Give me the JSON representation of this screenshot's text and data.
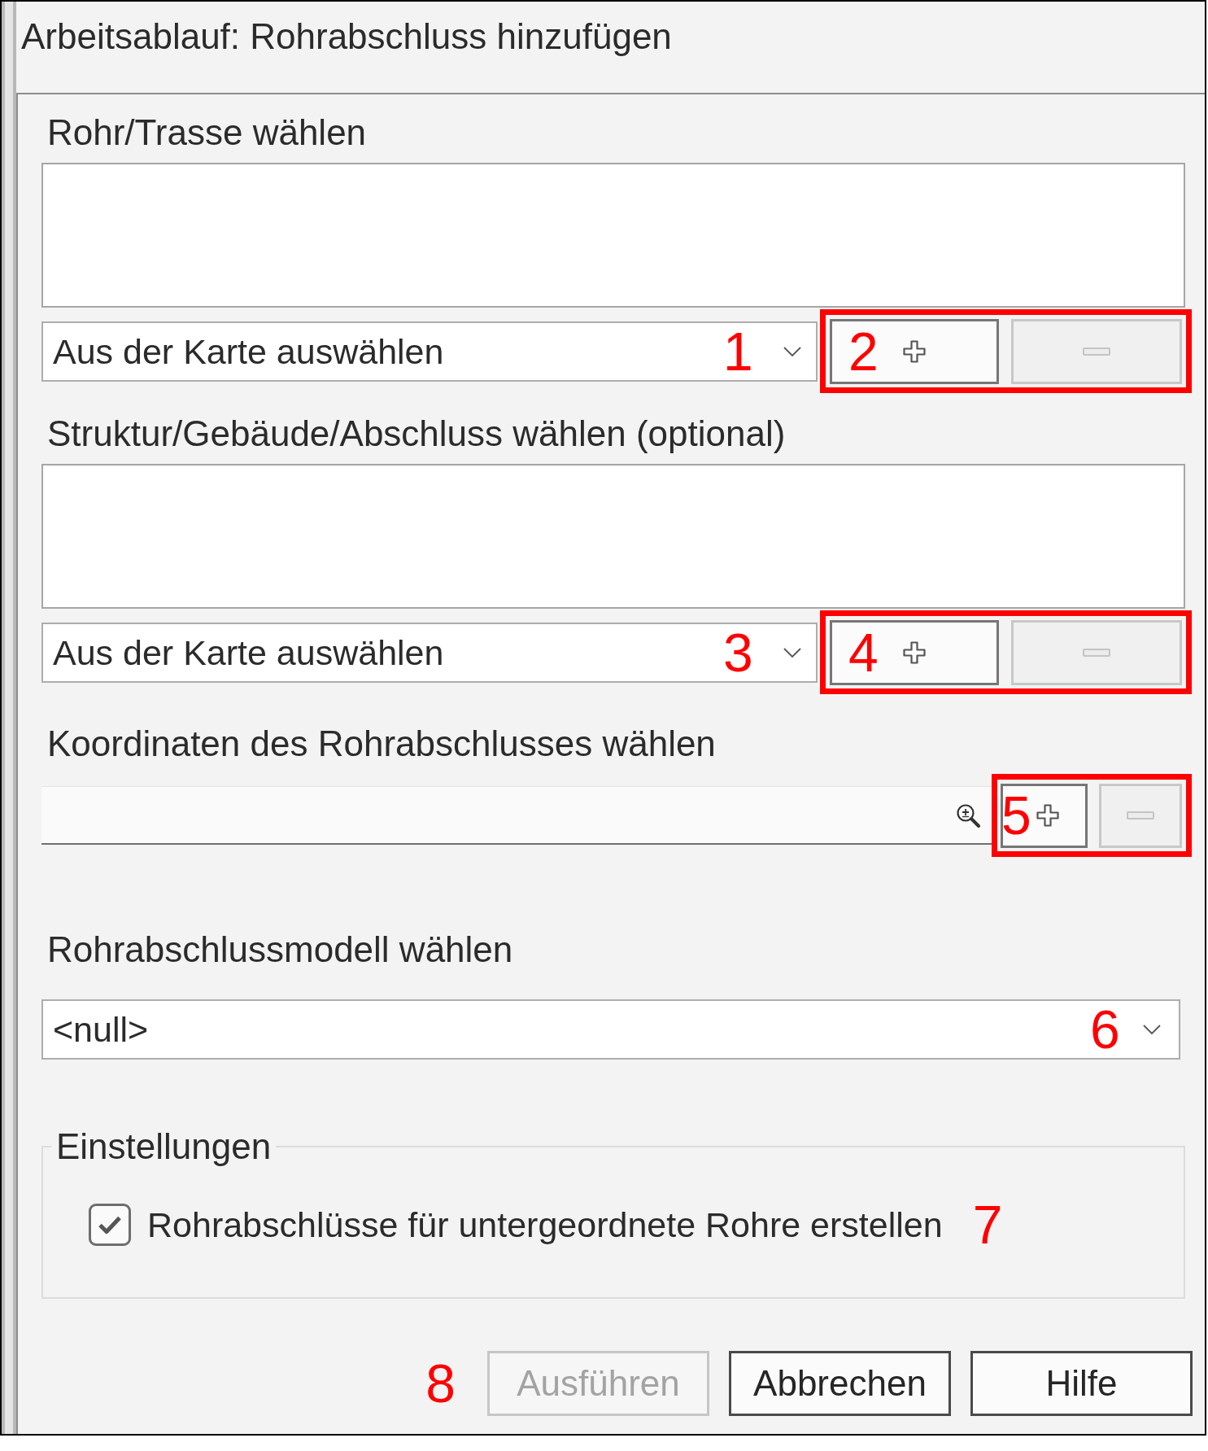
{
  "window": {
    "title": "Arbeitsablauf: Rohrabschluss hinzufügen"
  },
  "sections": [
    {
      "kind": "feature_picker",
      "label": "Rohr/Trasse wählen",
      "dropdown": {
        "value": "Aus der Karte auswählen",
        "annotation": "1"
      },
      "tools": {
        "highlighted": true,
        "annotation": "2",
        "add": {
          "disabled": false
        },
        "remove": {
          "disabled": true
        }
      }
    },
    {
      "kind": "feature_picker",
      "label": "Struktur/Gebäude/Abschluss wählen (optional)",
      "dropdown": {
        "value": "Aus der Karte auswählen",
        "annotation": "3"
      },
      "tools": {
        "highlighted": true,
        "annotation": "4",
        "add": {
          "disabled": false
        },
        "remove": {
          "disabled": true
        }
      }
    },
    {
      "kind": "coordinates",
      "label": "Koordinaten des Rohrabschlusses wählen",
      "tools": {
        "highlighted": true,
        "annotation": "5",
        "add": {
          "disabled": false
        },
        "remove": {
          "disabled": true
        }
      }
    },
    {
      "kind": "model",
      "label": "Rohrabschlussmodell wählen",
      "dropdown": {
        "value": "<null>",
        "annotation": "6"
      }
    }
  ],
  "settings": {
    "legend": "Einstellungen",
    "options": [
      {
        "label": "Rohrabschlüsse für untergeordnete Rohre erstellen",
        "checked": true,
        "annotation": "7"
      }
    ]
  },
  "footer": {
    "annotation": "8",
    "buttons": [
      {
        "label": "Ausführen",
        "disabled": true
      },
      {
        "label": "Abbrechen",
        "disabled": false
      },
      {
        "label": "Hilfe",
        "disabled": false
      }
    ]
  }
}
